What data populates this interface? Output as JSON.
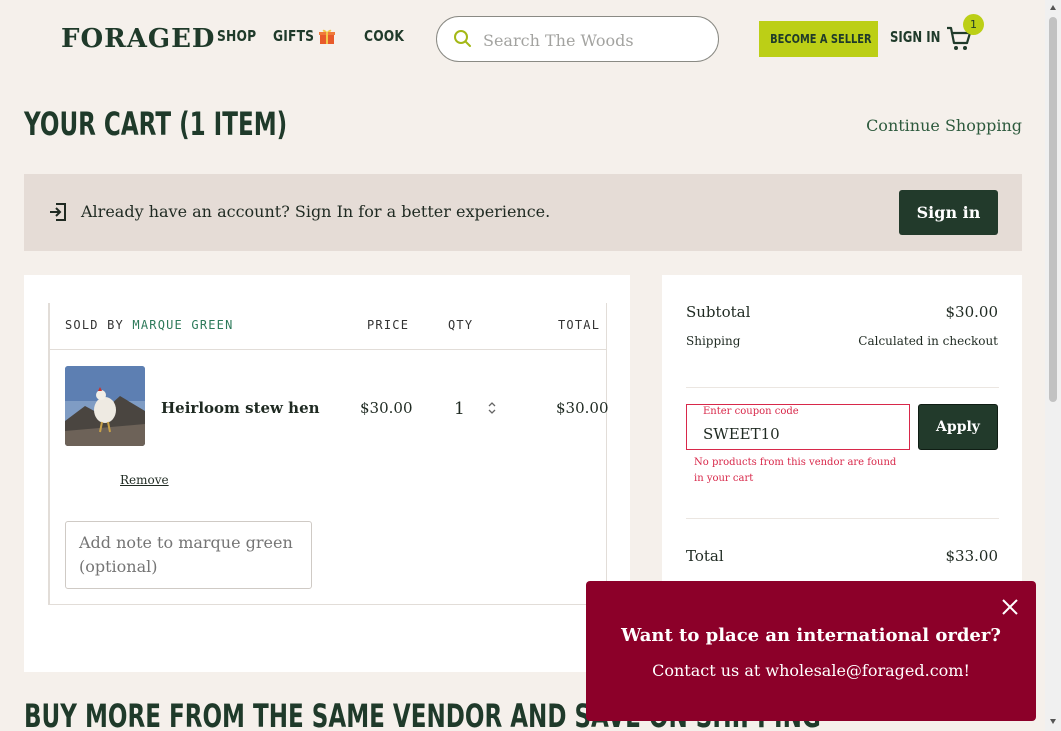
{
  "header": {
    "logo": "FORAGED",
    "nav": {
      "shop": "SHOP",
      "gifts": "GIFTS",
      "cook": "COOK"
    },
    "search_placeholder": "Search The Woods",
    "become_seller": "BECOME A SELLER",
    "sign_in": "SIGN IN",
    "cart_count": "1"
  },
  "cart": {
    "title": "YOUR CART (1 ITEM)",
    "continue_shopping": "Continue Shopping"
  },
  "banner": {
    "text": "Already have an account? Sign In for a better experience.",
    "button": "Sign in"
  },
  "vendor": {
    "sold_by_label": "SOLD BY",
    "vendor_name": "MARQUE GREEN",
    "col_price": "PRICE",
    "col_qty": "QTY",
    "col_total": "TOTAL",
    "item": {
      "name": "Heirloom stew hen",
      "price": "$30.00",
      "qty": "1",
      "total": "$30.00"
    },
    "remove": "Remove",
    "note_placeholder": "Add note to marque green (optional)"
  },
  "summary": {
    "subtotal_label": "Subtotal",
    "subtotal_value": "$30.00",
    "shipping_label": "Shipping",
    "shipping_value": "Calculated in checkout",
    "coupon_label": "Enter coupon code",
    "coupon_value": "SWEET10",
    "apply": "Apply",
    "coupon_error": "No products from this vendor are found in your cart",
    "total_label": "Total",
    "total_value": "$33.00"
  },
  "more_title": "BUY MORE FROM THE SAME VENDOR AND SAVE ON SHIPPING",
  "popup": {
    "heading": "Want to place an international order?",
    "body": "Contact us at wholesale@foraged.com!"
  },
  "colors": {
    "brand_green": "#1f3a2a",
    "accent_lime": "#bccf16",
    "error_red": "#d8284a",
    "popup_bg": "#8c0029"
  }
}
